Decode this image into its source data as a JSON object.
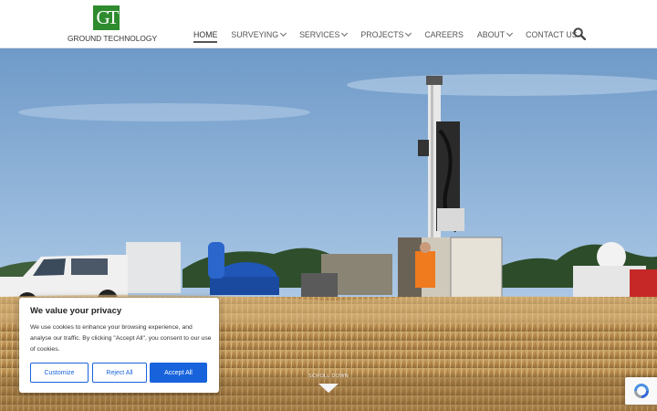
{
  "brand": {
    "logo_mark": "GT",
    "name": "GROUND TECHNOLOGY"
  },
  "nav": {
    "items": [
      {
        "label": "HOME",
        "active": true,
        "dropdown": false
      },
      {
        "label": "SURVEYING",
        "dropdown": true
      },
      {
        "label": "SERVICES",
        "dropdown": true
      },
      {
        "label": "PROJECTS",
        "dropdown": true
      },
      {
        "label": "CAREERS",
        "dropdown": false
      },
      {
        "label": "ABOUT",
        "dropdown": true
      },
      {
        "label": "CONTACT US",
        "dropdown": false
      }
    ],
    "search_icon": "search-icon"
  },
  "hero": {
    "scroll_label": "SCROLL DOWN",
    "scroll_icon": "chevron-down-icon"
  },
  "cookie": {
    "title": "We value your privacy",
    "body": "We use cookies to enhance your browsing experience, and analyse our traffic. By clicking \"Accept All\", you consent to our use of cookies.",
    "customize_label": "Customize",
    "reject_label": "Reject All",
    "accept_label": "Accept All"
  },
  "colors": {
    "accent": "#1863dc",
    "logo_green": "#2e8b2e"
  },
  "recaptcha_icon": "recaptcha-icon"
}
